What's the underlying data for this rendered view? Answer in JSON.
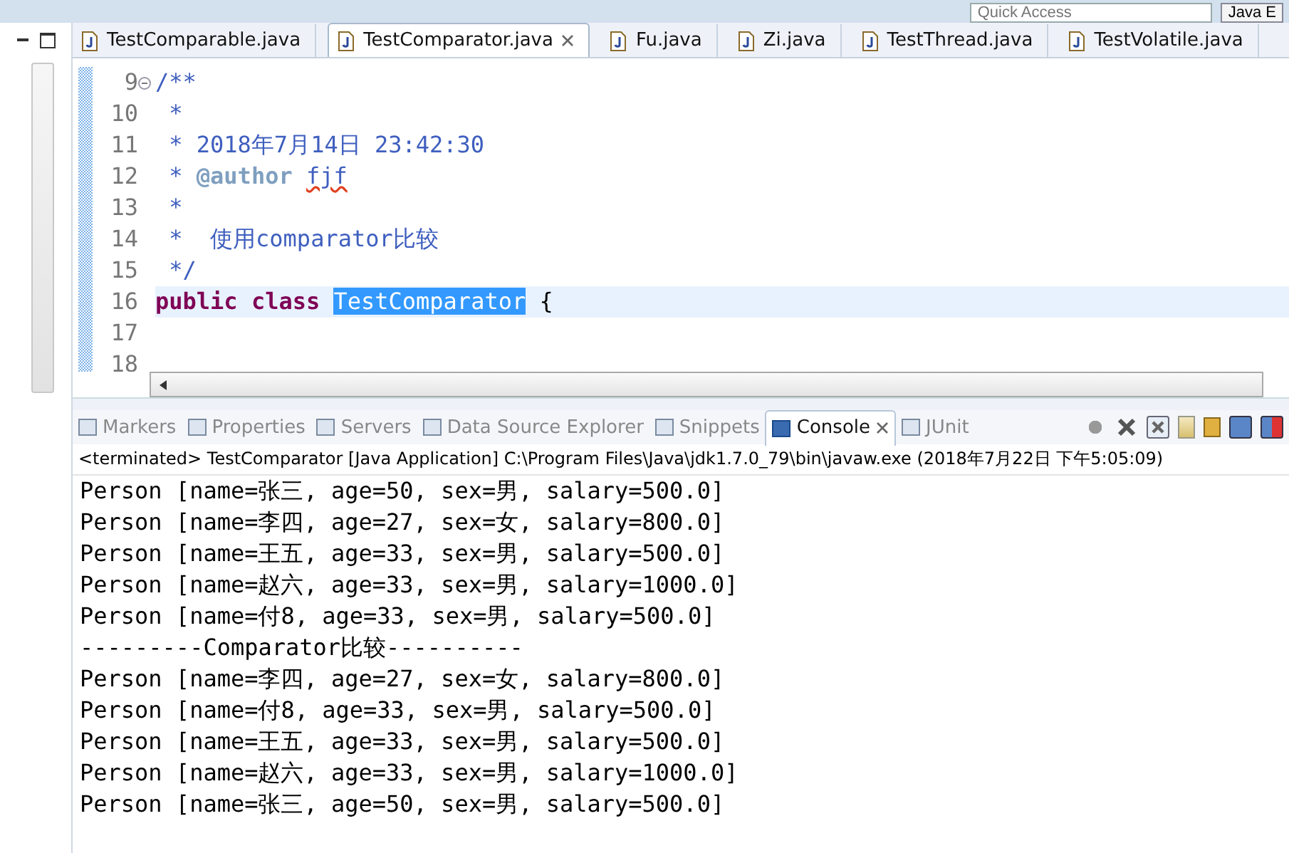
{
  "quick_access": {
    "placeholder": "Quick Access"
  },
  "perspective_button": {
    "label": "Java E"
  },
  "editor_tabs": [
    {
      "label": "TestComparable.java",
      "selected": false
    },
    {
      "label": "TestComparator.java",
      "selected": true
    },
    {
      "label": "Fu.java",
      "selected": false
    },
    {
      "label": "Zi.java",
      "selected": false
    },
    {
      "label": "TestThread.java",
      "selected": false
    },
    {
      "label": "TestVolatile.java",
      "selected": false
    }
  ],
  "code_lines": [
    {
      "number": "9",
      "folded": false,
      "current": false,
      "tokens": [
        {
          "kind": "comment",
          "text": "/**"
        }
      ]
    },
    {
      "number": "10",
      "current": false,
      "tokens": [
        {
          "kind": "comment",
          "text": " *"
        }
      ]
    },
    {
      "number": "11",
      "current": false,
      "tokens": [
        {
          "kind": "comment",
          "text": " * 2018年7月14日 23:42:30"
        }
      ]
    },
    {
      "number": "12",
      "current": false,
      "tokens": [
        {
          "kind": "comment",
          "text": " * "
        },
        {
          "kind": "tag",
          "text": "@author "
        },
        {
          "kind": "misspelled",
          "text": "fjf"
        }
      ]
    },
    {
      "number": "13",
      "current": false,
      "tokens": [
        {
          "kind": "comment",
          "text": " *"
        }
      ]
    },
    {
      "number": "14",
      "current": false,
      "tokens": [
        {
          "kind": "comment",
          "text": " *  使用comparator比较"
        }
      ]
    },
    {
      "number": "15",
      "current": false,
      "tokens": [
        {
          "kind": "comment",
          "text": " */"
        }
      ]
    },
    {
      "number": "16",
      "current": true,
      "tokens": [
        {
          "kind": "keyword",
          "text": "public "
        },
        {
          "kind": "keyword",
          "text": "class "
        },
        {
          "kind": "selected",
          "text": "TestComparator"
        },
        {
          "kind": "plain",
          "text": " {"
        }
      ]
    },
    {
      "number": "17",
      "current": false
    },
    {
      "number": "18",
      "current": false
    }
  ],
  "view_tabs": [
    {
      "label": "Markers",
      "selected": false
    },
    {
      "label": "Properties",
      "selected": false
    },
    {
      "label": "Servers",
      "selected": false
    },
    {
      "label": "Data Source Explorer",
      "selected": false
    },
    {
      "label": "Snippets",
      "selected": false
    },
    {
      "label": "Console",
      "selected": true
    },
    {
      "label": "JUnit",
      "selected": false
    }
  ],
  "console": {
    "status": "<terminated> TestComparator [Java Application] C:\\Program Files\\Java\\jdk1.7.0_79\\bin\\javaw.exe (2018年7月22日 下午5:05:09)",
    "lines": [
      "Person [name=张三, age=50, sex=男, salary=500.0]",
      "Person [name=李四, age=27, sex=女, salary=800.0]",
      "Person [name=王五, age=33, sex=男, salary=500.0]",
      "Person [name=赵六, age=33, sex=男, salary=1000.0]",
      "Person [name=付8, age=33, sex=男, salary=500.0]",
      "---------Comparator比较----------",
      "Person [name=李四, age=27, sex=女, salary=800.0]",
      "Person [name=付8, age=33, sex=男, salary=500.0]",
      "Person [name=王五, age=33, sex=男, salary=500.0]",
      "Person [name=赵六, age=33, sex=男, salary=1000.0]",
      "Person [name=张三, age=50, sex=男, salary=500.0]"
    ]
  }
}
